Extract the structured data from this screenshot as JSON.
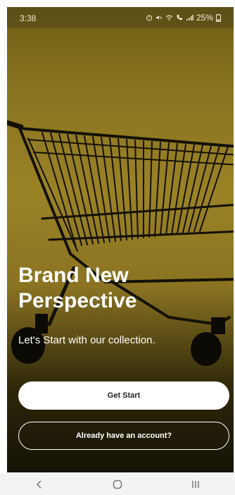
{
  "status_bar": {
    "time": "3:38",
    "icons": [
      "alarm-icon",
      "mute-icon",
      "wifi-icon",
      "call-icon",
      "signal-icon"
    ],
    "battery": "25%"
  },
  "hero": {
    "title_line1": "Brand New",
    "title_line2": "Perspective",
    "subtitle": "Let's Start with our collection."
  },
  "buttons": {
    "get_start": "Get Start",
    "login": "Already have an account?"
  },
  "nav": {
    "back_icon": "chevron-left-icon",
    "home_icon": "home-circle-icon",
    "recents_icon": "recents-icon"
  },
  "colors": {
    "background_gold": "#8a7420",
    "primary_button": "#ffffff",
    "text_light": "#ffffff"
  }
}
